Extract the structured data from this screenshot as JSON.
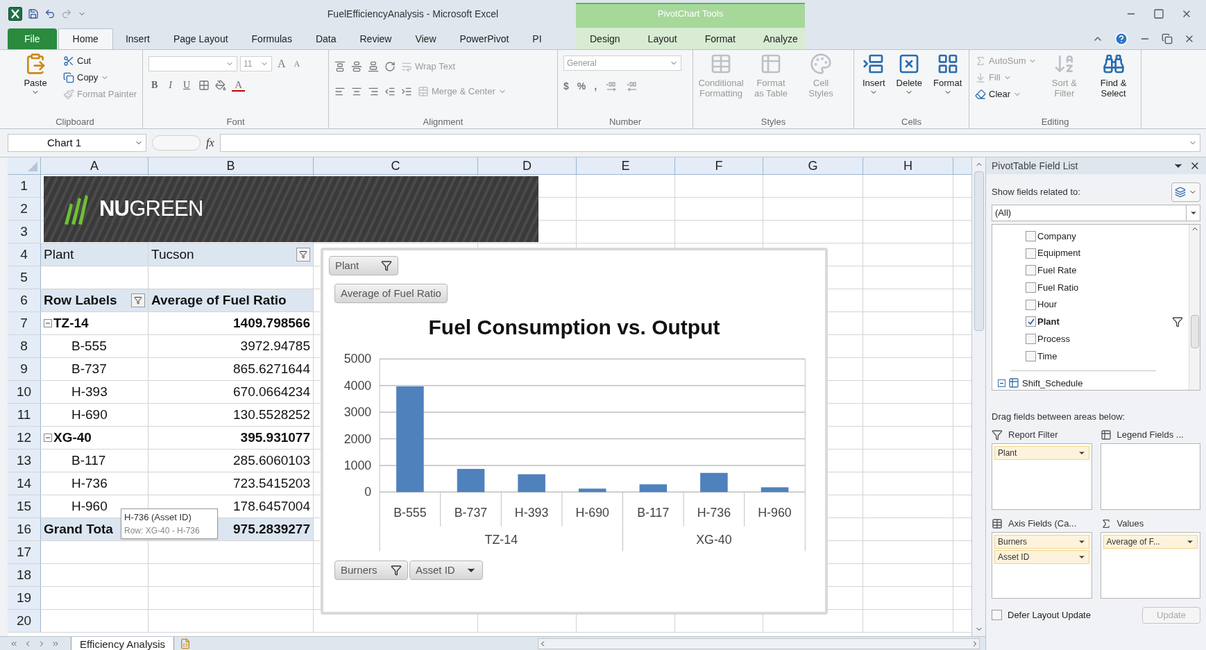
{
  "window": {
    "title": "FuelEfficiencyAnalysis  -  Microsoft Excel"
  },
  "contextual_group": {
    "title": "PivotChart Tools"
  },
  "tabs": [
    {
      "label": "File",
      "kind": "file",
      "selected": false
    },
    {
      "label": "Home",
      "kind": "main",
      "selected": true
    },
    {
      "label": "Insert",
      "kind": "main",
      "selected": false
    },
    {
      "label": "Page Layout",
      "kind": "main",
      "selected": false
    },
    {
      "label": "Formulas",
      "kind": "main",
      "selected": false
    },
    {
      "label": "Data",
      "kind": "main",
      "selected": false
    },
    {
      "label": "Review",
      "kind": "main",
      "selected": false
    },
    {
      "label": "View",
      "kind": "main",
      "selected": false
    },
    {
      "label": "PowerPivot",
      "kind": "main",
      "selected": false
    },
    {
      "label": "PI",
      "kind": "main",
      "selected": false
    },
    {
      "label": "Design",
      "kind": "contextual",
      "selected": false
    },
    {
      "label": "Layout",
      "kind": "contextual",
      "selected": false
    },
    {
      "label": "Format",
      "kind": "contextual",
      "selected": false
    },
    {
      "label": "Analyze",
      "kind": "contextual",
      "selected": false
    }
  ],
  "ribbon": {
    "clipboard": {
      "label": "Clipboard",
      "paste": {
        "label": "Paste",
        "disabled": false
      },
      "small": [
        {
          "label": "Cut",
          "disabled": false
        },
        {
          "label": "Copy",
          "disabled": false
        },
        {
          "label": "Format Painter",
          "disabled": true
        }
      ]
    },
    "font": {
      "label": "Font",
      "font_size": "11",
      "grow": "A",
      "shrink": "A",
      "styles": [
        "B",
        "I",
        "U"
      ],
      "font_color": "A"
    },
    "alignment": {
      "label": "Alignment",
      "wrap_text": {
        "label": "Wrap Text",
        "disabled": true
      },
      "merge": {
        "label": "Merge & Center",
        "disabled": true
      }
    },
    "number": {
      "label": "Number",
      "format": "General",
      "symbols": [
        "$",
        "%",
        ","
      ]
    },
    "styles": {
      "label": "Styles",
      "buttons": [
        {
          "label": "Conditional Formatting",
          "disabled": true
        },
        {
          "label": "Format as Table",
          "disabled": true
        },
        {
          "label": "Cell Styles",
          "disabled": true
        }
      ]
    },
    "cells": {
      "label": "Cells",
      "buttons": [
        {
          "label": "Insert",
          "disabled": false
        },
        {
          "label": "Delete",
          "disabled": false
        },
        {
          "label": "Format",
          "disabled": false
        }
      ]
    },
    "editing": {
      "label": "Editing",
      "small": [
        {
          "label": "AutoSum",
          "disabled": true
        },
        {
          "label": "Fill",
          "disabled": true
        },
        {
          "label": "Clear",
          "disabled": false
        }
      ],
      "large": [
        {
          "label": "Sort & Filter",
          "disabled": true
        },
        {
          "label": "Find & Select",
          "disabled": false
        }
      ]
    }
  },
  "formula_bar": {
    "name_box": "Chart 1",
    "fx": "fx"
  },
  "sheet": {
    "columns": [
      "A",
      "B",
      "C",
      "D",
      "E",
      "F",
      "G",
      "H"
    ],
    "row_numbers": [
      "1",
      "2",
      "3",
      "4",
      "5",
      "6",
      "7",
      "8",
      "9",
      "10",
      "11",
      "12",
      "13",
      "14",
      "15",
      "16",
      "17",
      "18",
      "19",
      "20"
    ]
  },
  "logo": {
    "text": "**NU**GREEN"
  },
  "pivot": {
    "filter": {
      "label": "Plant",
      "value": "Tucson"
    },
    "header": {
      "row_labels": "Row Labels",
      "values": "Average of Fuel Ratio"
    },
    "groups": [
      {
        "label": "TZ-14",
        "value": "1409.798566",
        "expanded": true,
        "children": [
          {
            "label": "B-555",
            "value": "3972.94785"
          },
          {
            "label": "B-737",
            "value": "865.6271644"
          },
          {
            "label": "H-393",
            "value": "670.0664234"
          },
          {
            "label": "H-690",
            "value": "130.5528252"
          }
        ]
      },
      {
        "label": "XG-40",
        "value": "395.931077",
        "expanded": true,
        "children": [
          {
            "label": "B-117",
            "value": "285.6060103"
          },
          {
            "label": "H-736",
            "value": "723.5415203"
          },
          {
            "label": "H-960",
            "value": "178.6457004"
          }
        ]
      }
    ],
    "grand_total": {
      "label": "Grand Tota",
      "value": "975.2839277"
    }
  },
  "tooltip": {
    "title": "H-736 (Asset ID)",
    "detail": "Row: XG-40 - H-736"
  },
  "chart": {
    "filter_button": {
      "label": "Plant",
      "filtered": true
    },
    "axis_buttons": [
      {
        "label": "Burners",
        "filtered": true
      },
      {
        "label": "Asset ID",
        "filtered": false
      }
    ],
    "axis_groups": [
      {
        "label": "TZ-14"
      },
      {
        "label": "XG-40"
      }
    ],
    "chart_data": {
      "type": "bar",
      "title": "Fuel Consumption vs. Output",
      "categories": [
        "B-555",
        "B-737",
        "H-393",
        "H-690",
        "B-117",
        "H-736",
        "H-960"
      ],
      "series": [
        {
          "name": "Average of Fuel Ratio",
          "color": "#4f81bd",
          "values": [
            3970,
            870,
            670,
            130,
            290,
            720,
            180
          ]
        }
      ],
      "grid": true,
      "ylim": [
        0,
        5000
      ],
      "yticks": [
        0,
        1000,
        2000,
        3000,
        4000,
        5000
      ]
    }
  },
  "field_list": {
    "title": "PivotTable Field List",
    "show_fields_label": "Show fields related to:",
    "related_to": "(All)",
    "fields": [
      {
        "label": "Company",
        "checked": false,
        "filtered": false
      },
      {
        "label": "Equipment",
        "checked": false,
        "filtered": false
      },
      {
        "label": "Fuel Rate",
        "checked": false,
        "filtered": false
      },
      {
        "label": "Fuel Ratio",
        "checked": false,
        "filtered": false
      },
      {
        "label": "Hour",
        "checked": false,
        "filtered": false
      },
      {
        "label": "Plant",
        "checked": true,
        "filtered": true
      },
      {
        "label": "Process",
        "checked": false,
        "filtered": false
      },
      {
        "label": "Time",
        "checked": false,
        "filtered": false
      }
    ],
    "table": {
      "label": "Shift_Schedule",
      "expanded": true
    },
    "drag_label": "Drag fields between areas below:",
    "areas": [
      {
        "label": "Report Filter",
        "kind": "filter",
        "items": [
          "Plant"
        ]
      },
      {
        "label": "Legend Fields ...",
        "kind": "legend"
      },
      {
        "label": "Axis Fields (Ca...",
        "kind": "axis",
        "items": [
          "Burners",
          "Asset ID"
        ]
      },
      {
        "label": "Values",
        "kind": "values",
        "items": [
          "Average of F..."
        ]
      }
    ],
    "defer": {
      "label": "Defer Layout Update",
      "checked": false
    },
    "update_button": {
      "label": "Update",
      "disabled": true
    }
  },
  "sheet_tabs": [
    {
      "label": "Efficiency Analysis",
      "selected": true
    }
  ]
}
